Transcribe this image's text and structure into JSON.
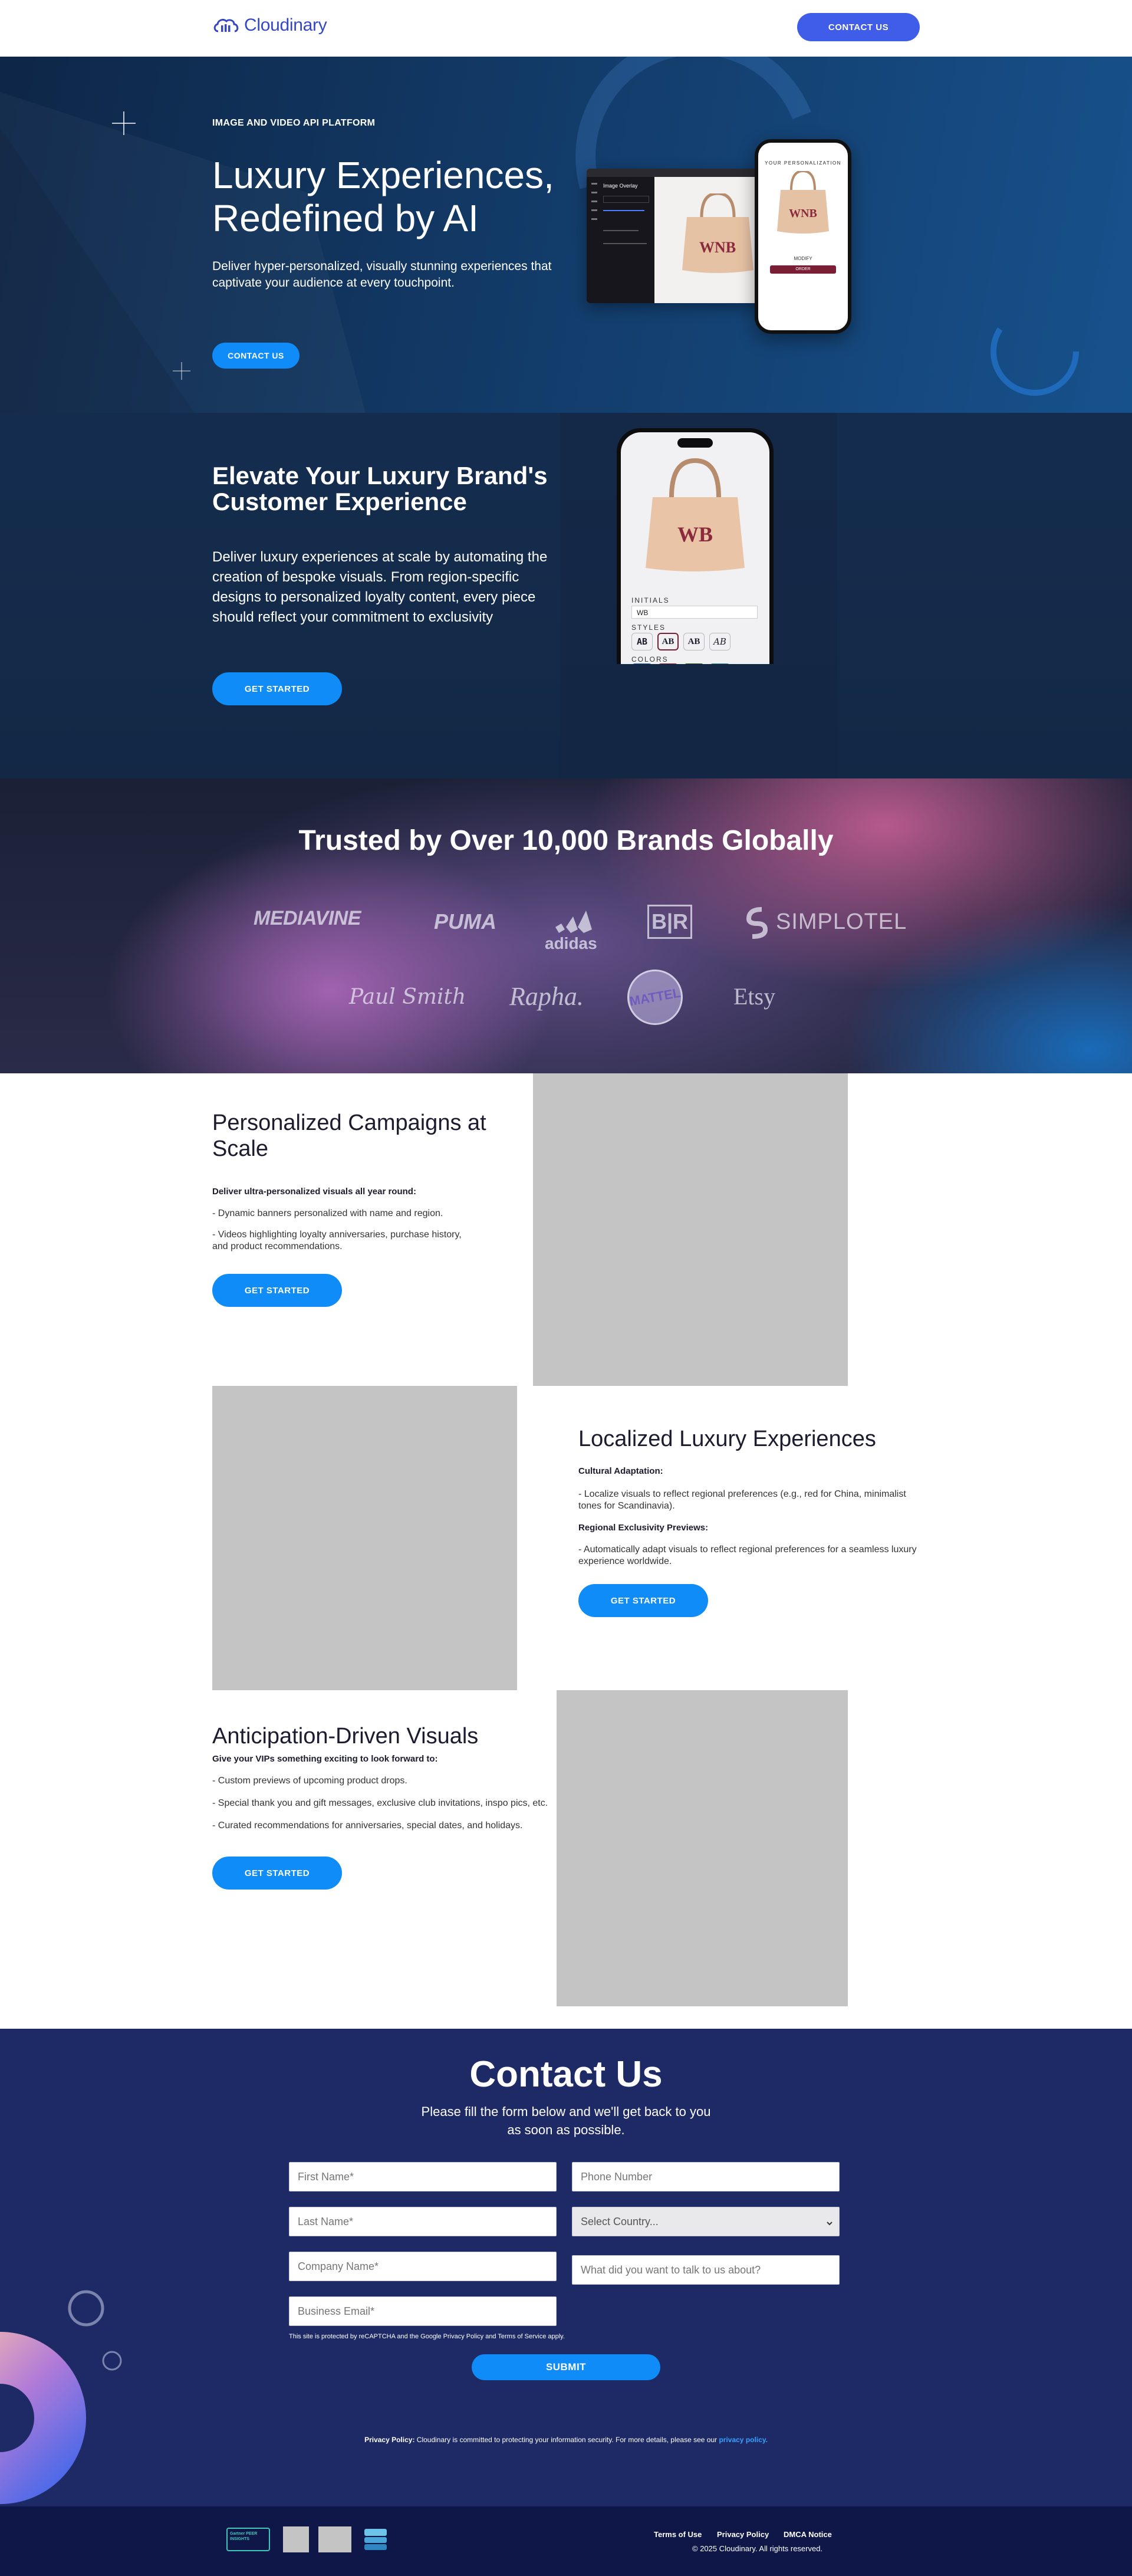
{
  "header": {
    "logo_text": "Cloudinary",
    "contact_button": "CONTACT US"
  },
  "hero": {
    "eyebrow": "IMAGE AND VIDEO API PLATFORM",
    "title": "Luxury Experiences, Redefined by AI",
    "description": "Deliver hyper-personalized, visually stunning experiences that captivate your audience at every touchpoint.",
    "cta": "CONTACT US",
    "mock": {
      "monogram": "WNB",
      "panel_title": "Image Overlay",
      "phone_title": "YOUR PERSONALIZATION",
      "modify_label": "MODIFY",
      "order_label": "ORDER"
    }
  },
  "elevate": {
    "title": "Elevate Your Luxury Brand's Customer Experience",
    "description": "Deliver luxury experiences at scale by automating the creation of bespoke visuals. From region-specific designs to personalized loyalty content, every piece should reflect your commitment to exclusivity",
    "cta": "GET STARTED",
    "phone": {
      "monogram": "WB",
      "initials_label": "INITIALS",
      "initials_value": "WB",
      "styles_label": "STYLES",
      "styles": [
        "AB",
        "AB",
        "AB",
        "AB"
      ],
      "colors_label": "COLORS",
      "swatches": [
        "#1f5fa8",
        "#9b1538",
        "#2f4a22",
        "#2e8a6f"
      ]
    }
  },
  "trusted": {
    "title": "Trusted by Over 10,000 Brands Globally",
    "logos_row1": [
      "MEDIAVINE",
      "PUMA",
      "adidas",
      "B|R",
      "SIMPLOTEL"
    ],
    "logos_row2": [
      "Paul Smith",
      "Rapha.",
      "MATTEL",
      "Etsy"
    ]
  },
  "campaigns": {
    "title": "Personalized Campaigns at Scale",
    "lead": "Deliver ultra-personalized visuals all year round:",
    "items": [
      "- Dynamic banners personalized with name and region.",
      "- Videos highlighting loyalty anniversaries, purchase history, and product recommendations."
    ],
    "cta": "GET STARTED"
  },
  "localized": {
    "title": "Localized Luxury Experiences",
    "sub1": "Cultural Adaptation:",
    "item1": "- Localize visuals to reflect regional preferences (e.g., red for China, minimalist tones for Scandinavia).",
    "sub2": "Regional Exclusivity Previews:",
    "item2": "- Automatically adapt visuals to reflect regional preferences for a seamless luxury experience worldwide.",
    "cta": "GET STARTED"
  },
  "anticipation": {
    "title": "Anticipation-Driven Visuals",
    "lead": "Give your VIPs something exciting to look forward to:",
    "items": [
      "- Custom previews of upcoming product drops.",
      "- Special thank you and gift messages, exclusive club invitations, inspo pics, etc.",
      "- Curated recommendations for anniversaries, special dates, and holidays."
    ],
    "cta": "GET STARTED"
  },
  "contact": {
    "title": "Contact Us",
    "subtitle": "Please fill the form below and we'll get back to you as soon as possible.",
    "placeholders": {
      "first_name": "First Name*",
      "phone": "Phone Number",
      "last_name": "Last Name*",
      "country": "Select Country...",
      "company": "Company Name*",
      "topic": "What did you want to talk to us about?",
      "email": "Business Email*"
    },
    "recaptcha": "This site is protected by reCAPTCHA and the Google Privacy Policy and Terms of Service apply.",
    "submit": "SUBMIT",
    "privacy_label": "Privacy Policy:",
    "privacy_text": " Cloudinary is committed to protecting your information security. For more details, please see our ",
    "privacy_link": "privacy policy."
  },
  "footer": {
    "links": [
      "Terms of Use",
      "Privacy Policy",
      "DMCA Notice"
    ],
    "copyright": "© 2025 Cloudinary. All rights reserved.",
    "badge_label": "Gartner PEER INSIGHTS"
  },
  "colors": {
    "brand_blue": "#3448c5",
    "cta_blue": "#0f8cf7",
    "contact_bg": "#1e2a66",
    "footer_bg": "#0f1748"
  }
}
